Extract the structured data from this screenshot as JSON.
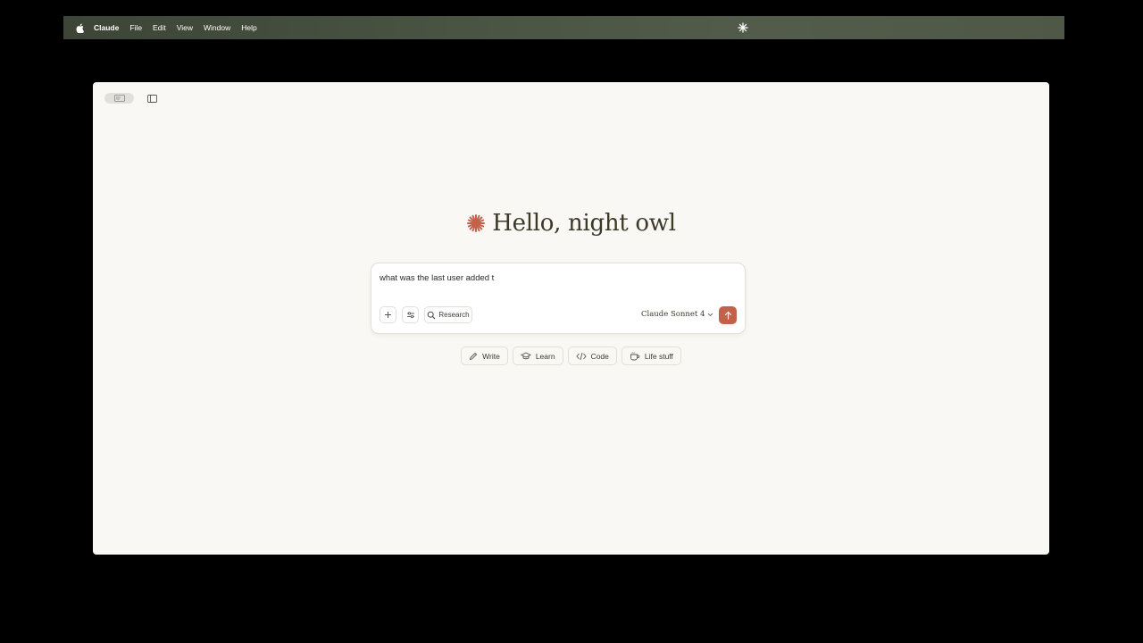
{
  "menubar": {
    "app_name": "Claude",
    "items": [
      "File",
      "Edit",
      "View",
      "Window",
      "Help"
    ]
  },
  "main": {
    "greeting": "Hello, night owl",
    "composer": {
      "input_value": "what was the last user added t",
      "research_label": "Research",
      "model_label": "Claude Sonnet 4"
    },
    "chips": [
      {
        "label": "Write",
        "icon": "pencil-icon"
      },
      {
        "label": "Learn",
        "icon": "graduation-cap-icon"
      },
      {
        "label": "Code",
        "icon": "code-icon"
      },
      {
        "label": "Life stuff",
        "icon": "coffee-cup-icon"
      }
    ]
  },
  "colors": {
    "accent": "#c4614a",
    "background": "#f9f8f4",
    "text": "#3d3929"
  }
}
